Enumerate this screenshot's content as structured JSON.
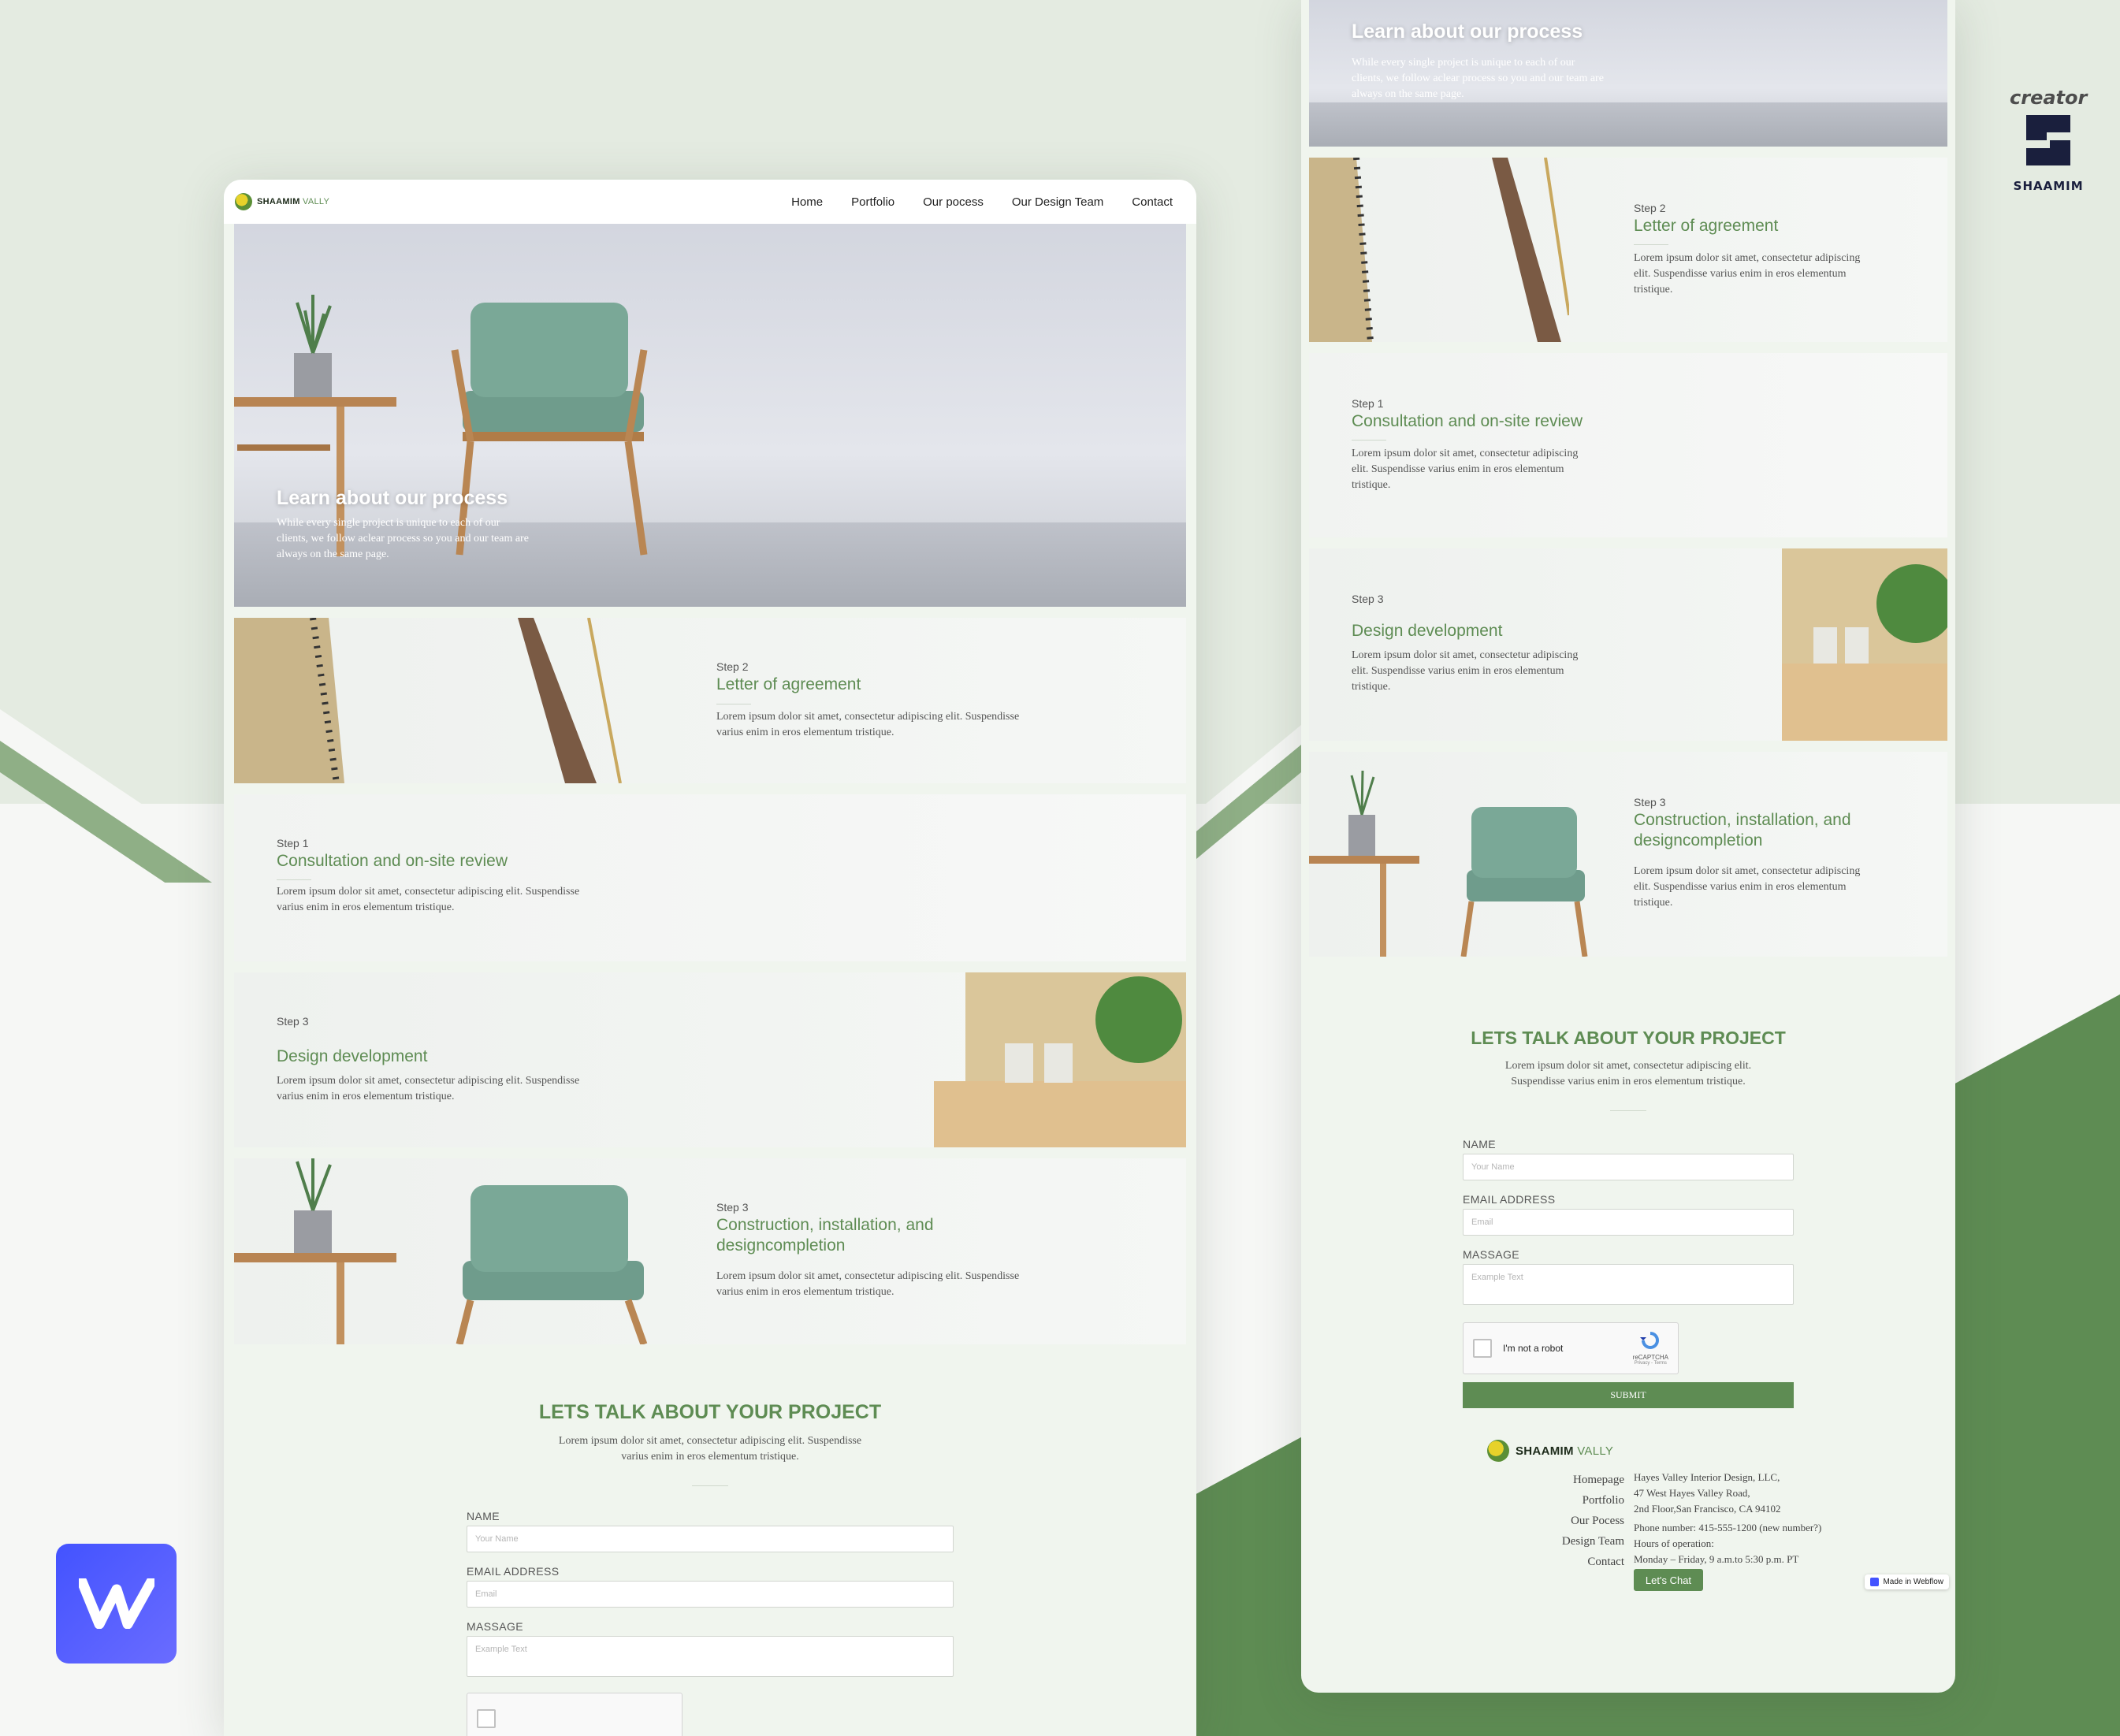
{
  "brand": {
    "name_bold": "SHAAMIM",
    "name_light": "VALLY"
  },
  "nav": [
    "Home",
    "Portfolio",
    "Our pocess",
    "Our Design Team",
    "Contact"
  ],
  "hero": {
    "title": "Learn about our process",
    "subtitle_l1": "While every single project is unique to each of our",
    "subtitle_l2": "clients, we follow aclear process so you and our team are",
    "subtitle_l3": "always on the same page."
  },
  "steps": [
    {
      "label": "Step 2",
      "title_l1": "Letter of agreement",
      "title_l2": "",
      "body_l1": "Lorem ipsum dolor sit amet, consectetur adipiscing elit. Suspendisse",
      "body_l2": "varius enim in eros elementum tristique.",
      "r_body_l1": "Lorem ipsum dolor sit amet, consectetur adipiscing",
      "r_body_l2": "elit. Suspendisse varius enim in eros elementum",
      "r_body_l3": "tristique."
    },
    {
      "label": "Step 1",
      "title_l1": "Consultation and on-site review",
      "title_l2": "",
      "body_l1": "Lorem ipsum dolor sit amet, consectetur adipiscing elit. Suspendisse",
      "body_l2": "varius enim in eros elementum tristique.",
      "r_body_l1": "Lorem ipsum dolor sit amet, consectetur adipiscing",
      "r_body_l2": "elit. Suspendisse varius enim in eros elementum",
      "r_body_l3": "tristique."
    },
    {
      "label": "Step 3",
      "title_l1": "Design development",
      "title_l2": "",
      "body_l1": "Lorem ipsum dolor sit amet, consectetur adipiscing elit. Suspendisse",
      "body_l2": "varius enim in eros elementum tristique.",
      "r_body_l1": "Lorem ipsum dolor sit amet, consectetur adipiscing",
      "r_body_l2": "elit. Suspendisse varius enim in eros elementum",
      "r_body_l3": "tristique."
    },
    {
      "label": "Step 3",
      "title_l1": "Construction, installation, and",
      "title_l2": "designcompletion",
      "body_l1": "Lorem ipsum dolor sit amet, consectetur adipiscing elit. Suspendisse",
      "body_l2": "varius enim in eros elementum tristique.",
      "r_body_l1": "Lorem ipsum dolor sit amet, consectetur adipiscing",
      "r_body_l2": "elit. Suspendisse varius enim in eros elementum",
      "r_body_l3": "tristique."
    }
  ],
  "contact": {
    "title": "LETS TALK ABOUT YOUR PROJECT",
    "sub_l1": "Lorem ipsum dolor sit amet, consectetur adipiscing elit. Suspendisse",
    "sub_l2": "varius enim in eros elementum tristique.",
    "r_sub_l1": "Lorem ipsum dolor sit amet, consectetur adipiscing elit.",
    "r_sub_l2": "Suspendisse varius enim in eros elementum tristique."
  },
  "form": {
    "name_label": "NAME",
    "name_placeholder": "Your Name",
    "email_label": "EMAIL ADDRESS",
    "email_placeholder": "Email",
    "message_label": "MASSAGE",
    "message_placeholder": "Example Text",
    "captcha_text": "I'm not a robot",
    "captcha_brand": "reCAPTCHA",
    "captcha_links": "Privacy - Terms",
    "submit_label": "SUBMIT"
  },
  "footer": {
    "links": [
      "Homepage",
      "Portfolio",
      "Our Pocess",
      "Design Team",
      "Contact"
    ],
    "address_l1": "Hayes Valley Interior Design, LLC,",
    "address_l2": "47 West Hayes Valley Road,",
    "address_l3": "2nd Floor,San Francisco, CA 94102",
    "phone": "Phone number: 415-555-1200 (new number?)",
    "hours_label": "Hours of operation:",
    "hours": "Monday – Friday, 9 a.m.to 5:30 p.m. PT",
    "chat_label": "Let's Chat",
    "made_in": "Made in Webflow"
  },
  "badges": {
    "creator": "creator",
    "creator_brand": "SHAAMIM"
  },
  "colors": {
    "accent": "#5e8c53",
    "webflow": "#4353ff",
    "bg": "#e4ebe1"
  }
}
